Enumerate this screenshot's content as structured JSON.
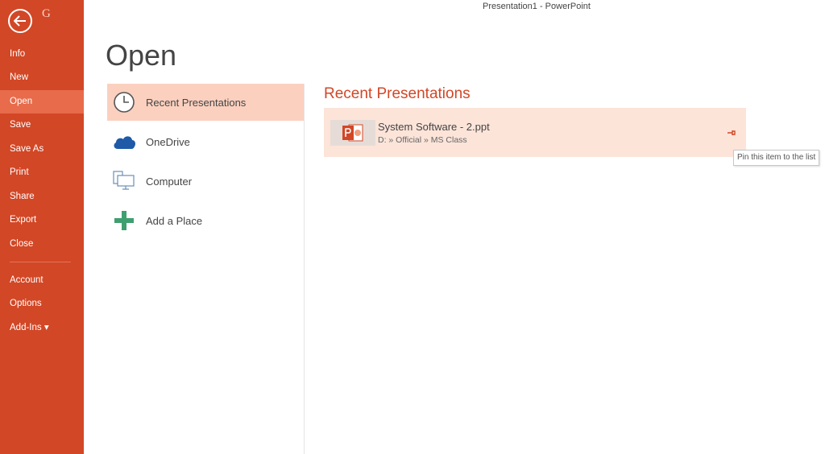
{
  "window": {
    "title": "Presentation1 - PowerPoint"
  },
  "nav": {
    "brand_letter": "G",
    "items": [
      {
        "label": "Info"
      },
      {
        "label": "New"
      },
      {
        "label": "Open",
        "active": true
      },
      {
        "label": "Save"
      },
      {
        "label": "Save As"
      },
      {
        "label": "Print"
      },
      {
        "label": "Share"
      },
      {
        "label": "Export"
      },
      {
        "label": "Close"
      },
      {
        "label": "Account"
      },
      {
        "label": "Options"
      },
      {
        "label": "Add-Ins ▾"
      }
    ]
  },
  "page": {
    "title": "Open"
  },
  "places": [
    {
      "label": "Recent Presentations",
      "icon": "clock-icon",
      "active": true
    },
    {
      "label": "OneDrive",
      "icon": "cloud-icon"
    },
    {
      "label": "Computer",
      "icon": "computer-icon"
    },
    {
      "label": "Add a Place",
      "icon": "plus-icon"
    }
  ],
  "recent": {
    "heading": "Recent Presentations",
    "files": [
      {
        "name": "System Software - 2.ppt",
        "path": "D: » Official » MS Class",
        "icon": "powerpoint-file-icon"
      }
    ],
    "pin_tooltip": "Pin this item to the list"
  },
  "colors": {
    "accent": "#d24726",
    "nav_active": "#e86b4b",
    "place_active": "#fbd0bf",
    "file_row": "#fce4d9",
    "onedrive_blue": "#1e5aa8",
    "plus_green": "#3f9f6f"
  }
}
